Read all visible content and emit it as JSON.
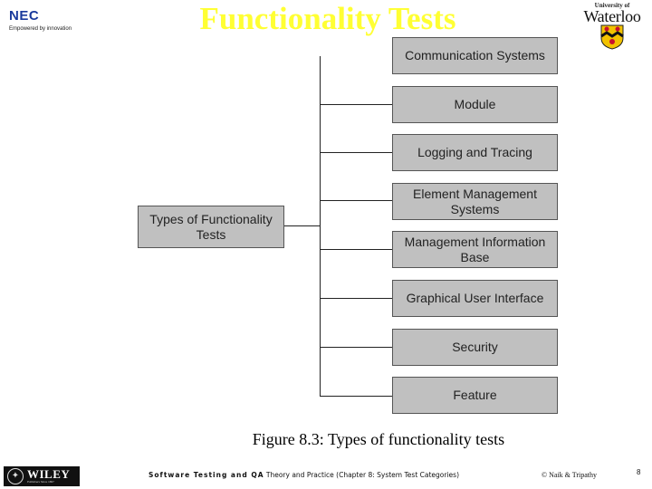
{
  "slide": {
    "title": "Functionality Tests",
    "page_number": "8"
  },
  "logos": {
    "nec": {
      "name": "NEC",
      "tagline": "Empowered by innovation",
      "color": "#1a3a9c"
    },
    "waterloo": {
      "small": "University of",
      "big": "Waterloo"
    },
    "wiley": {
      "name": "WILEY",
      "sub": "Publishers Since 1807"
    }
  },
  "diagram": {
    "root": {
      "label": "Types of Functionality Tests"
    },
    "children": [
      {
        "label": "Communication Systems"
      },
      {
        "label": "Module"
      },
      {
        "label": "Logging and Tracing"
      },
      {
        "label": "Element Management Systems"
      },
      {
        "label": "Management Information Base"
      },
      {
        "label": "Graphical User Interface"
      },
      {
        "label": "Security"
      },
      {
        "label": "Feature"
      }
    ],
    "colors": {
      "node_fill": "#c0c0c0",
      "node_border": "#555555",
      "connector": "#222222",
      "title": "#ffff33"
    }
  },
  "caption": "Figure 8.3: Types of functionality tests",
  "footer": {
    "book_bold": "Software Testing and QA",
    "book_rest": " Theory and Practice (Chapter 8: System Test Categories)",
    "copyright": "© Naik & Tripathy"
  }
}
